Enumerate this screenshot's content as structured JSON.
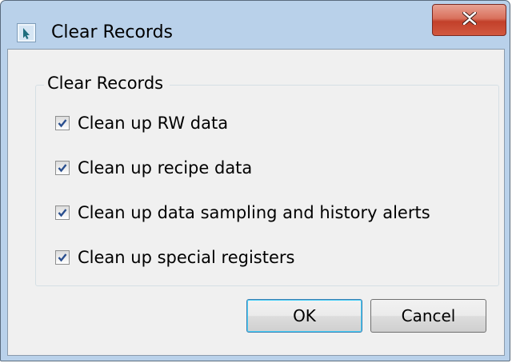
{
  "window": {
    "title": "Clear Records",
    "close_icon": "close-icon"
  },
  "group": {
    "legend": "Clear Records",
    "options": [
      {
        "label": "Clean up RW data",
        "checked": true
      },
      {
        "label": "Clean up recipe data",
        "checked": true
      },
      {
        "label": "Clean up data sampling and history alerts",
        "checked": true
      },
      {
        "label": "Clean up special registers",
        "checked": true
      }
    ]
  },
  "buttons": {
    "ok": "OK",
    "cancel": "Cancel"
  },
  "colors": {
    "frame": "#b9d1ea",
    "close_button": "#c7432c",
    "client": "#f0f0f0",
    "checkmark": "#2a4f8f"
  }
}
